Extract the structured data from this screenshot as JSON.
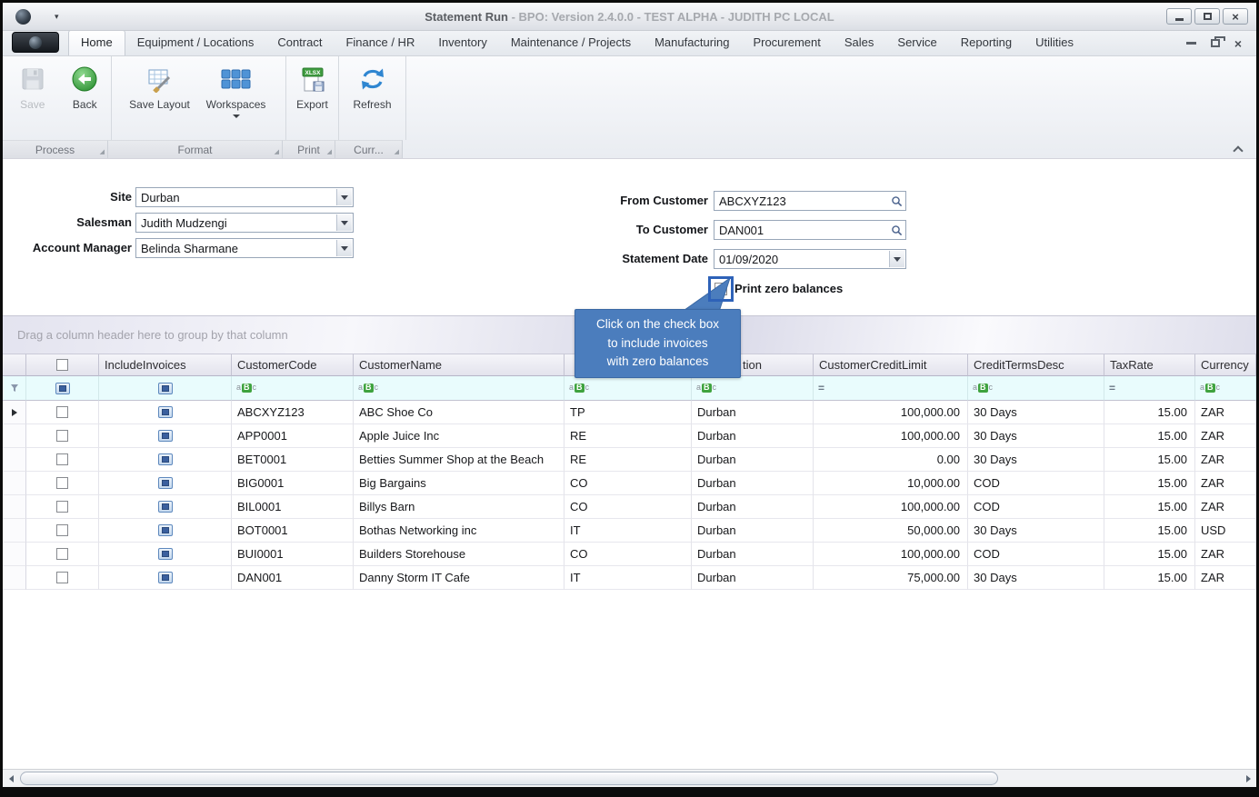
{
  "window": {
    "title": "Statement Run",
    "title_suffix": " - BPO: Version 2.4.0.0 - TEST ALPHA - JUDITH PC LOCAL"
  },
  "ribbon": {
    "tabs": [
      {
        "label": "Home",
        "selected": true
      },
      {
        "label": "Equipment / Locations",
        "selected": false
      },
      {
        "label": "Contract",
        "selected": false
      },
      {
        "label": "Finance / HR",
        "selected": false
      },
      {
        "label": "Inventory",
        "selected": false
      },
      {
        "label": "Maintenance / Projects",
        "selected": false
      },
      {
        "label": "Manufacturing",
        "selected": false
      },
      {
        "label": "Procurement",
        "selected": false
      },
      {
        "label": "Sales",
        "selected": false
      },
      {
        "label": "Service",
        "selected": false
      },
      {
        "label": "Reporting",
        "selected": false
      },
      {
        "label": "Utilities",
        "selected": false
      }
    ],
    "groups": [
      {
        "caption": "Process",
        "buttons": [
          {
            "label": "Save",
            "disabled": true
          },
          {
            "label": "Back",
            "disabled": false
          }
        ]
      },
      {
        "caption": "Format",
        "buttons": [
          {
            "label": "Save Layout"
          },
          {
            "label": "Workspaces",
            "has_dropdown": true
          }
        ]
      },
      {
        "caption": "Print",
        "buttons": [
          {
            "label": "Export"
          }
        ]
      },
      {
        "caption": "Curr...",
        "buttons": [
          {
            "label": "Refresh"
          }
        ]
      }
    ],
    "export_icon_text": "XLSX"
  },
  "form": {
    "site": {
      "label": "Site",
      "value": "Durban"
    },
    "salesman": {
      "label": "Salesman",
      "value": "Judith Mudzengi"
    },
    "account_manager": {
      "label": "Account Manager",
      "value": "Belinda Sharmane"
    },
    "from_customer": {
      "label": "From Customer",
      "value": "ABCXYZ123"
    },
    "to_customer": {
      "label": "To Customer",
      "value": "DAN001"
    },
    "statement_date": {
      "label": "Statement Date",
      "value": "01/09/2020"
    },
    "print_zero_balances": {
      "label": "Print zero balances",
      "checked": false
    }
  },
  "callout": {
    "lines": [
      "Click on the check box",
      "to include invoices",
      "with zero balances"
    ],
    "color": "#4b7dbd"
  },
  "grid": {
    "group_panel_text": "Drag a column header here to group by that column",
    "columns": [
      {
        "label": ""
      },
      {
        "label": "IncludeInvoices"
      },
      {
        "label": "CustomerCode"
      },
      {
        "label": "CustomerName"
      },
      {
        "label": ""
      },
      {
        "label": "tion"
      },
      {
        "label": "CustomerCreditLimit"
      },
      {
        "label": "CreditTermsDesc"
      },
      {
        "label": "TaxRate"
      },
      {
        "label": "Currency"
      }
    ],
    "filter_icons": {
      "a": "a",
      "b": "B",
      "c": "c",
      "eq": "="
    },
    "rows": [
      {
        "current": true,
        "checked": false,
        "code": "ABCXYZ123",
        "name": "ABC Shoe Co",
        "type": "TP",
        "site": "Durban",
        "credit_limit": "100,000.00",
        "terms": "30 Days",
        "tax_rate": "15.00",
        "currency": "ZAR"
      },
      {
        "current": false,
        "checked": false,
        "code": "APP0001",
        "name": "Apple Juice Inc",
        "type": "RE",
        "site": "Durban",
        "credit_limit": "100,000.00",
        "terms": "30 Days",
        "tax_rate": "15.00",
        "currency": "ZAR"
      },
      {
        "current": false,
        "checked": false,
        "code": "BET0001",
        "name": "Betties Summer Shop at the Beach",
        "type": "RE",
        "site": "Durban",
        "credit_limit": "0.00",
        "terms": "30 Days",
        "tax_rate": "15.00",
        "currency": "ZAR"
      },
      {
        "current": false,
        "checked": false,
        "code": "BIG0001",
        "name": "Big Bargains",
        "type": "CO",
        "site": "Durban",
        "credit_limit": "10,000.00",
        "terms": "COD",
        "tax_rate": "15.00",
        "currency": "ZAR"
      },
      {
        "current": false,
        "checked": false,
        "code": "BIL0001",
        "name": "Billys Barn",
        "type": "CO",
        "site": "Durban",
        "credit_limit": "100,000.00",
        "terms": "COD",
        "tax_rate": "15.00",
        "currency": "ZAR"
      },
      {
        "current": false,
        "checked": false,
        "code": "BOT0001",
        "name": "Bothas Networking inc",
        "type": "IT",
        "site": "Durban",
        "credit_limit": "50,000.00",
        "terms": "30 Days",
        "tax_rate": "15.00",
        "currency": "USD"
      },
      {
        "current": false,
        "checked": false,
        "code": "BUI0001",
        "name": "Builders Storehouse",
        "type": "CO",
        "site": "Durban",
        "credit_limit": "100,000.00",
        "terms": "COD",
        "tax_rate": "15.00",
        "currency": "ZAR"
      },
      {
        "current": false,
        "checked": false,
        "code": "DAN001",
        "name": "Danny Storm IT Cafe",
        "type": "IT",
        "site": "Durban",
        "credit_limit": "75,000.00",
        "terms": "30 Days",
        "tax_rate": "15.00",
        "currency": "ZAR"
      }
    ]
  }
}
